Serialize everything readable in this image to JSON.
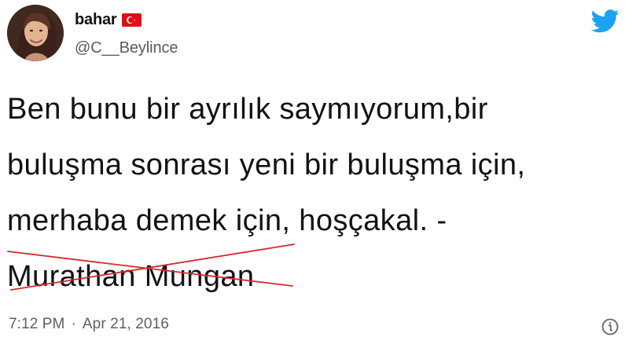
{
  "header": {
    "display_name": "bahar",
    "handle": "@C__Beylince",
    "flag_icon": "turkey-flag-icon",
    "brand_icon": "twitter-bird-icon",
    "brand_color": "#1DA1F2"
  },
  "tweet": {
    "lines": [
      "Ben bunu bir ayrılık saymıyorum,bir",
      "buluşma sonrası yeni bir buluşma için,",
      "merhaba demek için, hoşçakal. -"
    ],
    "author_attribution": "Murathan Mungan",
    "strike_color": "#d7282b"
  },
  "footer": {
    "time": "7:12 PM",
    "separator": "·",
    "date": "Apr 21, 2016",
    "info_icon": "info-icon"
  }
}
